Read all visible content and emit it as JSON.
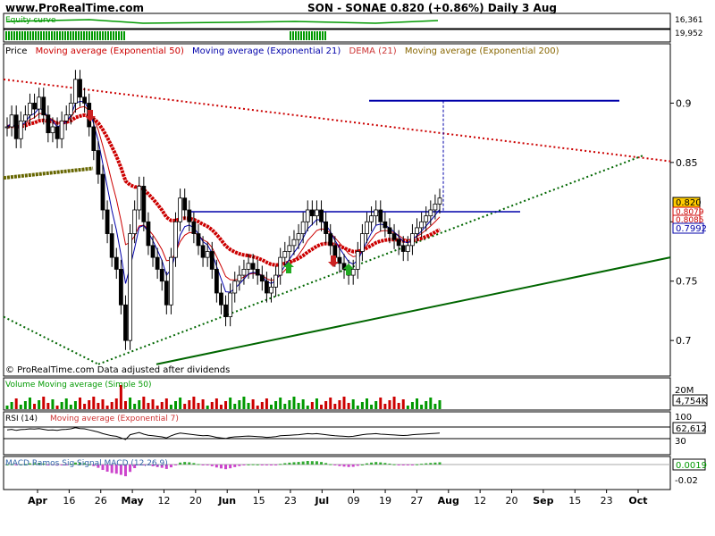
{
  "header": {
    "site": "www.ProRealTime.com",
    "quote": "SON - SONAE    0.820 (+0.86%)    Daily  3 Aug"
  },
  "equity_panel": {
    "label": "Equity curve",
    "value_top": "16,361",
    "value_bottom": "19,952"
  },
  "price_panel": {
    "legend": {
      "price": "Price",
      "ema50": "Moving average (Exponential 50)",
      "ema21": "Moving average (Exponential 21)",
      "dema": "DEMA (21)",
      "ema200": "Moving average (Exponential 200)"
    },
    "footer": "© ProRealTime.com  Data adjusted after dividends",
    "badges": {
      "last": "0.820",
      "b2": "0.8079",
      "b3": "0.8085",
      "ema21": "0.7992"
    }
  },
  "volume_panel": {
    "label": "Volume Moving average (Simple 50)",
    "tick_top": "20M",
    "badge": "4,754K"
  },
  "rsi_panel": {
    "label": "RSI (14)",
    "label2": "Moving average (Exponential 7)",
    "tick_100": "100",
    "badge": "62,612",
    "tick_30": "30"
  },
  "macd_panel": {
    "label": "MACD Ramos Sig Signal MACD (12,26,9)",
    "badge": "0.0019",
    "tick": "-0.02"
  },
  "colors": {
    "candle_up": "#ffffff",
    "candle_down": "#000000",
    "ema50": "#cc0000",
    "ema21": "#0000aa",
    "ema200": "#cc0000",
    "green_line": "#006600",
    "volume_up": "#009900",
    "volume_down": "#cc0000"
  },
  "chart_data": {
    "type": "candlestick",
    "title": "SON - SONAE 0.820 (+0.86%) Daily 3 Aug",
    "x_tick_labels": [
      "Apr",
      "16",
      "26",
      "May",
      "12",
      "20",
      "Jun",
      "15",
      "23",
      "Jul",
      "09",
      "19",
      "27",
      "Aug",
      "12",
      "20",
      "Sep",
      "15",
      "23",
      "Oct"
    ],
    "y_ticks": [
      0.7,
      0.75,
      0.8,
      0.85,
      0.9
    ],
    "y_tick_labels": [
      "0.7",
      "0.75",
      "0.8",
      "0.85",
      "0.9"
    ],
    "ylim": [
      0.67,
      0.95
    ],
    "last_close": 0.82,
    "change_pct": 0.86,
    "series": {
      "close": [
        0.88,
        0.89,
        0.87,
        0.885,
        0.89,
        0.9,
        0.895,
        0.905,
        0.89,
        0.875,
        0.88,
        0.87,
        0.885,
        0.89,
        0.9,
        0.92,
        0.905,
        0.9,
        0.88,
        0.86,
        0.84,
        0.81,
        0.79,
        0.77,
        0.76,
        0.73,
        0.7,
        0.79,
        0.81,
        0.83,
        0.8,
        0.78,
        0.77,
        0.76,
        0.75,
        0.73,
        0.77,
        0.8,
        0.82,
        0.81,
        0.8,
        0.79,
        0.78,
        0.77,
        0.775,
        0.76,
        0.74,
        0.73,
        0.72,
        0.74,
        0.75,
        0.755,
        0.76,
        0.765,
        0.76,
        0.755,
        0.75,
        0.74,
        0.745,
        0.755,
        0.77,
        0.775,
        0.78,
        0.785,
        0.79,
        0.8,
        0.81,
        0.805,
        0.81,
        0.8,
        0.79,
        0.78,
        0.77,
        0.765,
        0.76,
        0.755,
        0.76,
        0.775,
        0.79,
        0.8,
        0.805,
        0.81,
        0.8,
        0.795,
        0.79,
        0.785,
        0.78,
        0.775,
        0.78,
        0.79,
        0.795,
        0.8,
        0.805,
        0.81,
        0.815,
        0.82
      ],
      "high_line_level": 0.902,
      "resistance_level": 0.8085
    }
  }
}
